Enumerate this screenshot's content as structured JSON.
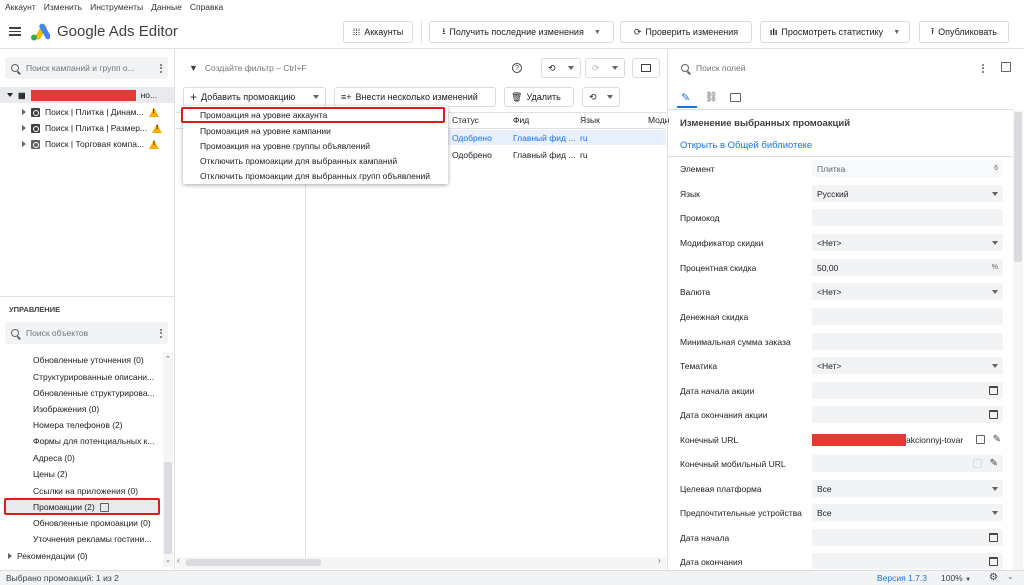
{
  "menubar": [
    "Аккаунт",
    "Изменить",
    "Инструменты",
    "Данные",
    "Справка"
  ],
  "header": {
    "app_title": "Google Ads Editor",
    "accounts_btn": "Аккаунты",
    "get_changes_btn": "Получить последние изменения",
    "check_changes_btn": "Проверить изменения",
    "view_stats_btn": "Просмотреть статистику",
    "publish_btn": "Опубликовать"
  },
  "tree": {
    "search_placeholder": "Поиск кампаний и групп о...",
    "account_suffix": "но...",
    "campaigns": [
      {
        "label": "Поиск | Плитка | Динам..."
      },
      {
        "label": "Поиск | Плитка | Размер..."
      },
      {
        "label": "Поиск | Торговая компа..."
      }
    ]
  },
  "manage": {
    "title": "УПРАВЛЕНИЕ",
    "search_placeholder": "Поиск объектов",
    "items": [
      "Обновленные уточнения (0)",
      "Структурированные описани...",
      "Обновленные структурирова...",
      "Изображения (0)",
      "Номера телефонов (2)",
      "Формы для потенциальных к...",
      "Адреса (0)",
      "Цены (2)",
      "Ссылки на приложения (0)",
      "Промоакции (2)",
      "Обновленные промоакции (0)",
      "Уточнения рекламы гостини..."
    ],
    "recommendations": "Рекомендации (0)"
  },
  "toolbar": {
    "filter_placeholder": "Создайте фильтр – Ctrl+F",
    "add_promo": "Добавить промоакцию",
    "bulk_changes": "Внести несколько изменений",
    "delete": "Удалить"
  },
  "dropdown": [
    "Промоакция на уровне аккаунта",
    "Промоакция на уровне кампании",
    "Промоакция на уровне группы объявлений",
    "Отключить промоакции для выбранных кампаний",
    "Отключить промоакции для выбранных групп объявлений"
  ],
  "table": {
    "columns": [
      "Статус",
      "Фид",
      "Язык",
      "Моди"
    ],
    "rows": [
      {
        "status": "Одобрено",
        "feed": "Главный фид ...",
        "lang": "ru"
      },
      {
        "status": "Одобрено",
        "feed": "Главный фид ...",
        "lang": "ru"
      }
    ]
  },
  "right": {
    "search_placeholder": "Поиск полей",
    "section_title": "Изменение выбранных промоакций",
    "library_link": "Открыть в Общей библиотеке",
    "fields": [
      {
        "label": "Элемент",
        "value": "Плитка",
        "extra": "6"
      },
      {
        "label": "Язык",
        "value": "Русский"
      },
      {
        "label": "Промокод",
        "value": ""
      },
      {
        "label": "Модификатор скидки",
        "value": "<Нет>"
      },
      {
        "label": "Процентная скидка",
        "value": "50,00",
        "extra": "%"
      },
      {
        "label": "Валюта",
        "value": "<Нет>"
      },
      {
        "label": "Денежная скидка",
        "value": ""
      },
      {
        "label": "Минимальная сумма заказа",
        "value": ""
      },
      {
        "label": "Тематика",
        "value": "<Нет>"
      },
      {
        "label": "Дата начала акции",
        "value": ""
      },
      {
        "label": "Дата окончания акции",
        "value": ""
      },
      {
        "label": "Конечный URL",
        "value": "akcionnyj-tovar"
      },
      {
        "label": "Конечный мобильный URL",
        "value": ""
      },
      {
        "label": "Целевая платформа",
        "value": "Все"
      },
      {
        "label": "Предпочтительные устройства",
        "value": "Все"
      },
      {
        "label": "Дата начала",
        "value": ""
      },
      {
        "label": "Дата окончания",
        "value": ""
      }
    ]
  },
  "status": {
    "selection": "Выбрано промоакций: 1 из 2",
    "version": "Версия 1.7.3",
    "zoom": "100%"
  },
  "colors": {
    "accent": "#1a73e8",
    "highlight": "#e01b1b",
    "warning": "#f9ab00"
  }
}
